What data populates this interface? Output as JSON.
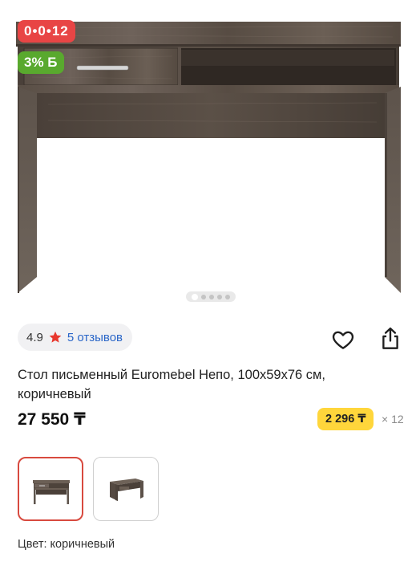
{
  "badges": {
    "installment": "0•0•12",
    "bonus": "3% Б"
  },
  "gallery": {
    "total_images": 5,
    "active_index": 0
  },
  "rating": {
    "value": "4.9",
    "reviews_label": "5 отзывов"
  },
  "product": {
    "title": "Стол письменный Euromebel Непо, 100x59x76 см, коричневый",
    "price": "27 550 ₸",
    "monthly_payment": "2 296 ₸",
    "installment_term": "× 12",
    "color_label": "Цвет: коричневый"
  },
  "colors": {
    "installment_badge": "#e84545",
    "bonus_badge": "#59a92e",
    "monthly_pill": "#ffd63b",
    "reviews_link": "#2a66c8",
    "star": "#e8382e",
    "selected_thumb_border": "#d84a3f"
  },
  "icons": {
    "rating": "star-icon",
    "favorite": "heart-icon",
    "share": "share-icon"
  }
}
